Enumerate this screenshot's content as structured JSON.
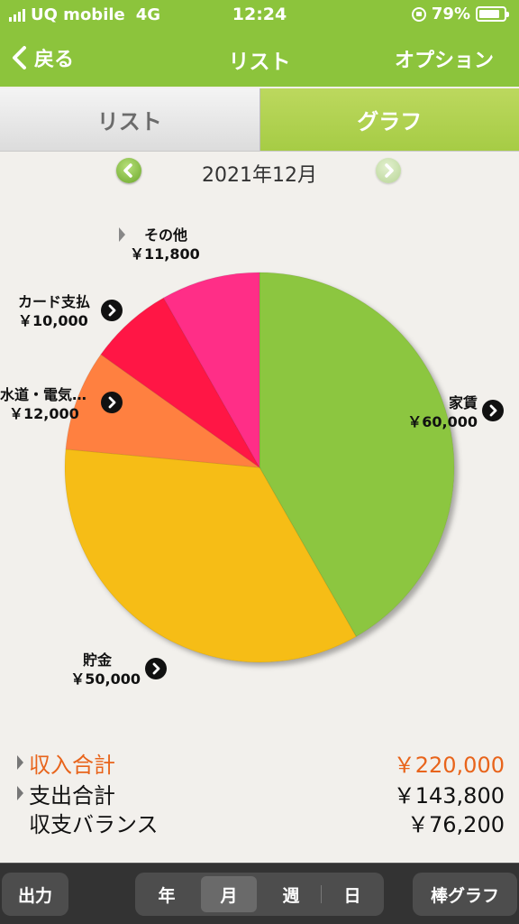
{
  "status_bar": {
    "carrier": "UQ mobile",
    "network": "4G",
    "time": "12:24",
    "battery": "79%"
  },
  "nav": {
    "back_label": "戻る",
    "title": "リスト",
    "option_label": "オプション"
  },
  "segments": {
    "list": "リスト",
    "graph": "グラフ",
    "selected": "graph"
  },
  "month": "2021年12月",
  "chart_data": {
    "type": "pie",
    "slices": [
      {
        "label": "家賃",
        "amount": "￥60,000",
        "value": 60000,
        "color": "#8cc63f"
      },
      {
        "label": "貯金",
        "amount": "￥50,000",
        "value": 50000,
        "color": "#f6bd12"
      },
      {
        "label": "水道・電気…",
        "amount": "￥12,000",
        "value": 12000,
        "color": "#ff8040"
      },
      {
        "label": "カード支払",
        "amount": "￥10,000",
        "value": 10000,
        "color": "#ff1744"
      },
      {
        "label": "その他",
        "amount": "￥11,800",
        "value": 11800,
        "color": "#ff2d87"
      }
    ]
  },
  "summary": {
    "income_label": "収入合計",
    "income_value": "￥220,000",
    "expense_label": "支出合計",
    "expense_value": "￥143,800",
    "balance_label": "収支バランス",
    "balance_value": "￥76,200",
    "income_color": "#e8641b"
  },
  "toolbar": {
    "output": "出力",
    "year": "年",
    "month": "月",
    "week": "週",
    "day": "日",
    "bar_graph": "棒グラフ",
    "selected_period": "month"
  }
}
